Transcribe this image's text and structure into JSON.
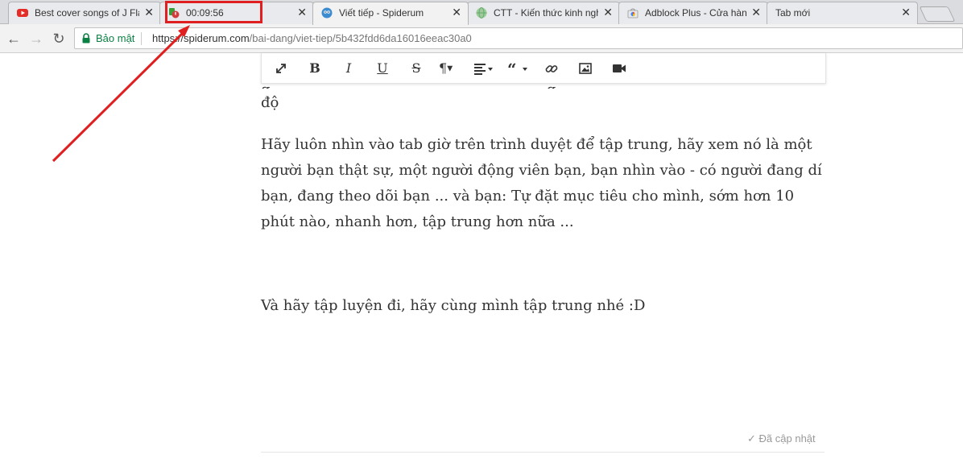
{
  "tabs": [
    {
      "title": "Best cover songs of J Fla",
      "favicon": "youtube-icon"
    },
    {
      "title": "00:09:56",
      "favicon": "timer-extension-icon"
    },
    {
      "title": "Viết tiếp - Spiderum",
      "favicon": "spiderum-icon",
      "active": true
    },
    {
      "title": "CTT - Kiến thức kinh ngh",
      "favicon": "globe-icon"
    },
    {
      "title": "Adblock Plus - Cửa hàng",
      "favicon": "chrome-store-icon"
    },
    {
      "title": "Tab mới",
      "favicon": ""
    }
  ],
  "close_glyph": "✕",
  "toolbar": {
    "back_glyph": "←",
    "forward_glyph": "→",
    "reload_glyph": "↻",
    "secure_label": "Bảo mật",
    "url_host": "https://spiderum.com",
    "url_path": "/bai-dang/viet-tiep/5b432fdd6da16016eeac30a0"
  },
  "editor": {
    "bold": "B",
    "italic": "I",
    "underline": "U",
    "strike": "S",
    "paragraph": "¶"
  },
  "article": {
    "top_fragment": "độ",
    "paragraph_1": "Hãy luôn nhìn vào tab giờ trên trình duyệt để tập trung, hãy xem nó là một người bạn thật sự, một người động viên bạn, bạn nhìn vào - có người đang dí bạn, đang theo dõi bạn ... và bạn: Tự đặt mục tiêu cho mình, sớm hơn 10 phút nào, nhanh hơn, tập trung hơn nữa ...",
    "paragraph_2": "Và hãy tập luyện đi, hãy cùng mình tập trung nhé :D"
  },
  "status": {
    "check_glyph": "✓",
    "label": "Đã cập nhật"
  },
  "colors": {
    "annotation_red": "#e02020",
    "secure_green": "#0b8043"
  }
}
